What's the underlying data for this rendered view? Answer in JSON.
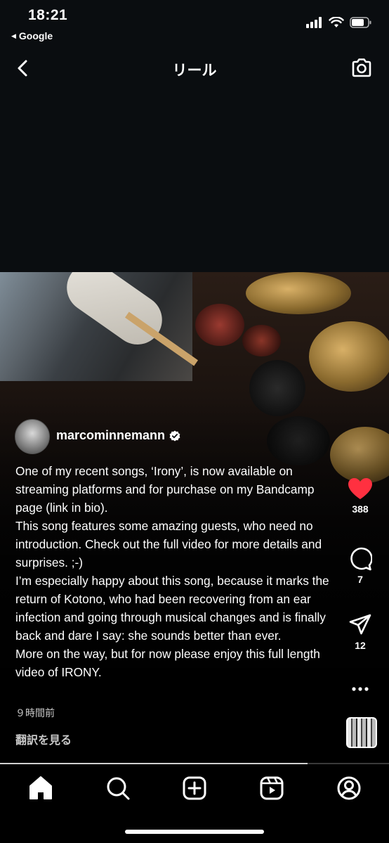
{
  "status": {
    "time": "18:21",
    "back_app": "Google"
  },
  "header": {
    "title": "リール"
  },
  "reel": {
    "username": "marcominnemann",
    "caption": [
      "One of my recent songs, ‘Irony’, is now available on streaming platforms and for purchase on my Bandcamp page (link in bio).",
      "This song features some amazing guests, who need no introduction. Check out the full video for more details and surprises. ;-)",
      "I’m especially happy about this song, because it marks the return of Kotono, who had been recovering from an ear infection and going through musical changes and is finally back and dare I say: she sounds better than ever.",
      "More on the way, but for now please enjoy this full length video of IRONY."
    ],
    "time_ago": "９時間前",
    "translate_label": "翻訳を見る",
    "likes": "388",
    "comments": "7",
    "shares": "12",
    "like_color": "#ff3040",
    "progress": 0.79
  },
  "icons": {
    "back": "chevron-left-icon",
    "camera": "camera-icon",
    "like": "heart-icon",
    "comment": "comment-icon",
    "share": "send-icon",
    "more": "more-icon",
    "tabs": [
      "home-icon",
      "search-icon",
      "create-icon",
      "reels-icon",
      "profile-icon"
    ]
  }
}
